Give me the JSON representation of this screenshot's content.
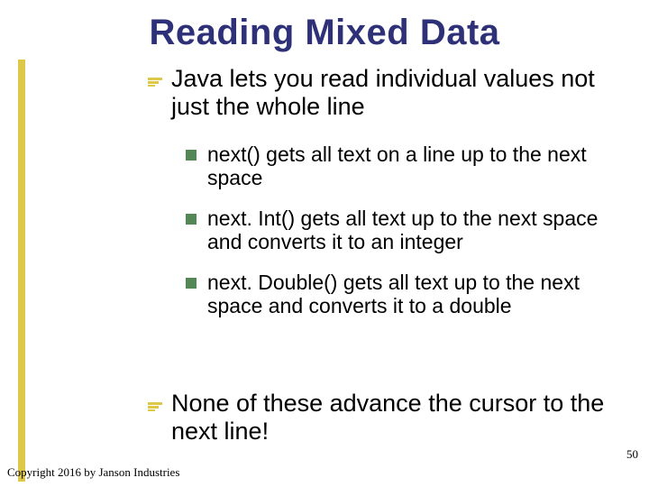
{
  "title": "Reading Mixed Data",
  "bullets": [
    {
      "text": "Java lets you read individual values not just the whole line",
      "sub": [
        "next() gets all text on a line up to the next space",
        "next. Int() gets all text up to the next space and converts it to an integer",
        "next. Double() gets all text up to the next space and converts it to a double"
      ]
    },
    {
      "text": "None of these advance the cursor to the next line!"
    }
  ],
  "footer": "Copyright 2016 by Janson Industries",
  "page_number": "50",
  "colors": {
    "title": "#2f3178",
    "level1_bullet": "#ddc84a",
    "level2_bullet": "#548656",
    "sidebar": "#ddc84a"
  }
}
